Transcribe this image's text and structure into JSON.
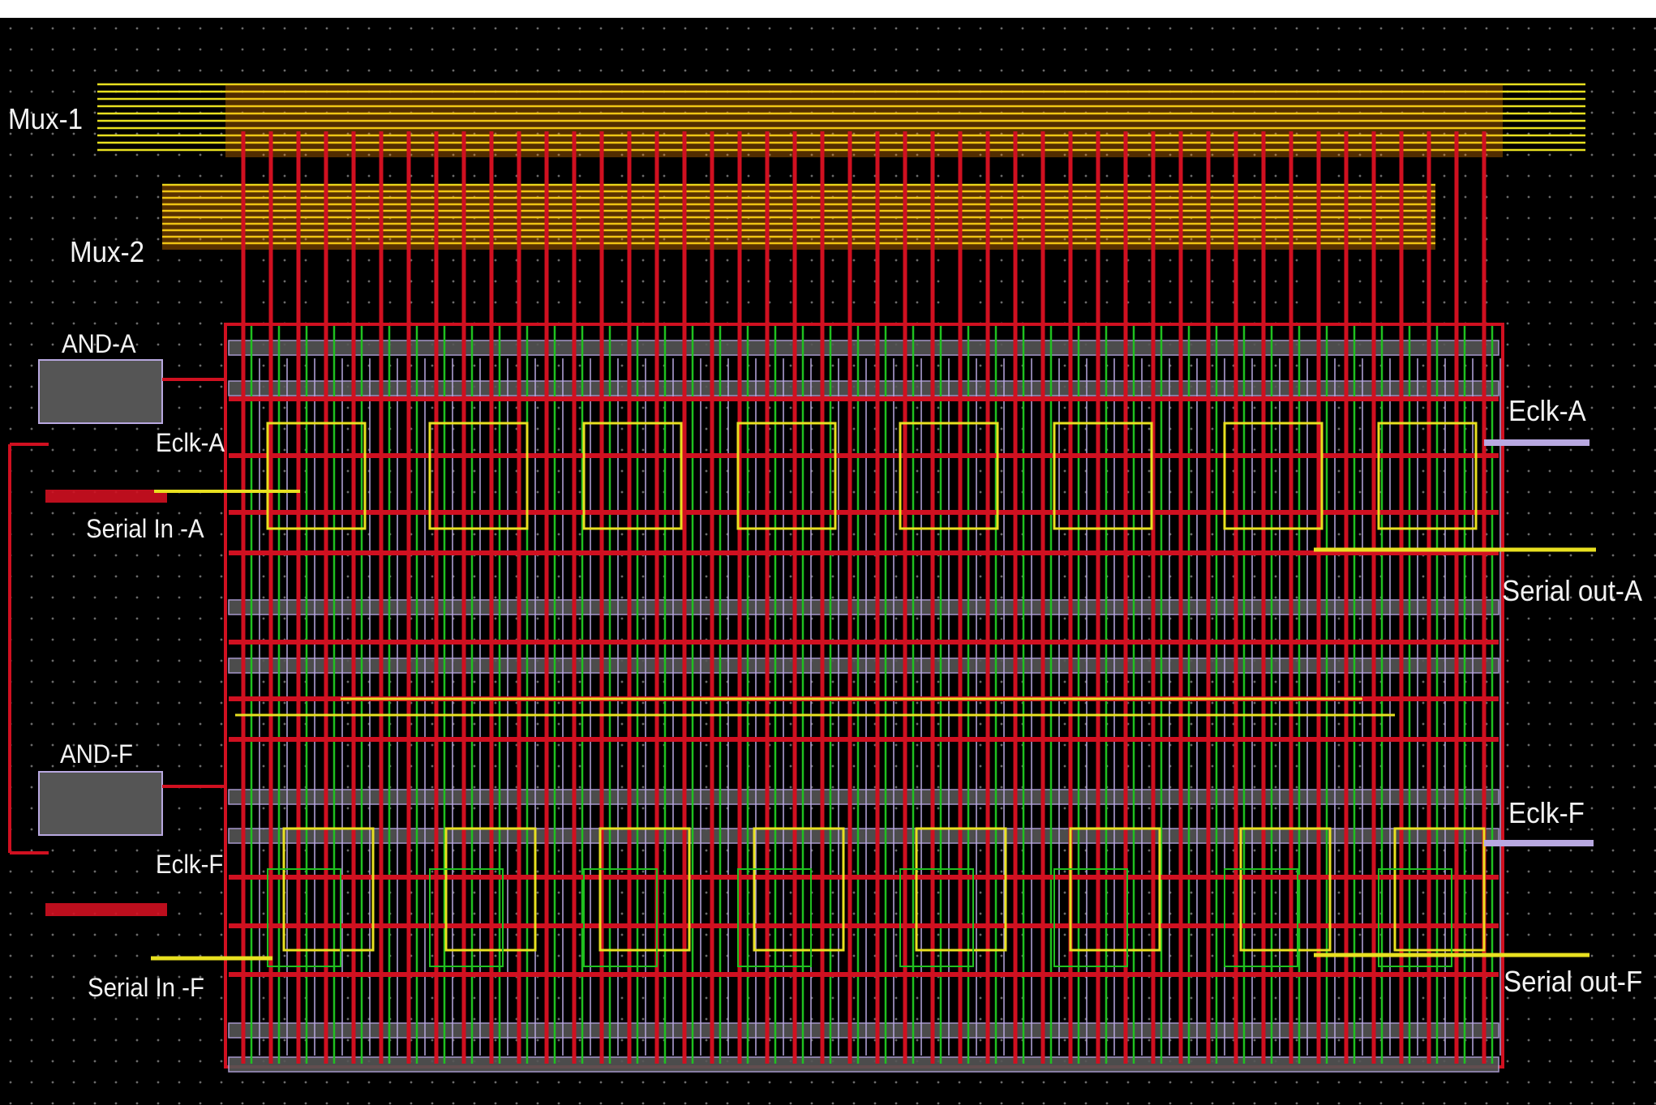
{
  "labels": {
    "mux1": "Mux-1",
    "mux2": "Mux-2",
    "and_a": "AND-A",
    "eclk_a_left": "Eclk-A",
    "serial_in_a": "Serial In -A",
    "eclk_a_right": "Eclk-A",
    "serial_out_a": "Serial out-A",
    "and_f": "AND-F",
    "eclk_f_left": "Eclk-F",
    "serial_in_f": "Serial In -F",
    "eclk_f_right": "Eclk-F",
    "serial_out_f": "Serial out-F"
  },
  "layer_colors": {
    "background": "#000000",
    "grid_dot": "#6a6a6a",
    "metal_yellow": "#e8e020",
    "metal_orange": "#ff8c00",
    "poly_red": "#d01020",
    "diffusion_green": "#20c020",
    "via_lavender": "#b8a8e0",
    "well_gray": "#555555"
  }
}
